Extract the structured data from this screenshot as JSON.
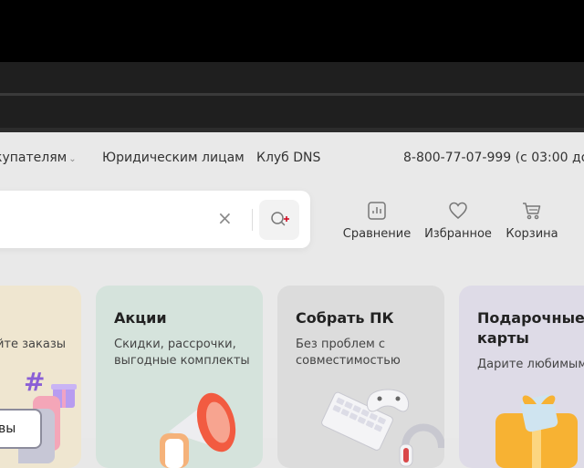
{
  "nav": {
    "buyers": "купателям",
    "legal": "Юридическим лицам",
    "club": "Клуб DNS",
    "phone": "8-800-77-07-999 (с 03:00 до"
  },
  "search": {
    "clear_glyph": "×"
  },
  "actions": {
    "compare": "Сравнение",
    "favorites": "Избранное",
    "cart": "Корзина"
  },
  "cards": {
    "orders": {
      "subtitle": "айте заказы",
      "chip": "вы"
    },
    "promo": {
      "title": "Акции",
      "subtitle": "Скидки, рассрочки, выгодные комплекты"
    },
    "pc": {
      "title": "Собрать ПК",
      "subtitle": "Без проблем с совместимостью"
    },
    "gift": {
      "title": "Подарочные карты",
      "subtitle": "Дарите любимым"
    }
  },
  "icons": {
    "search": "search-icon",
    "compare": "chart-icon",
    "favorites": "heart-icon",
    "cart": "cart-icon",
    "clear": "close-icon"
  },
  "colors": {
    "accent": "#fc8507",
    "search_plus": "#d0021b",
    "page_bg": "#e9e9e9",
    "promo_card": "#d5e3dc",
    "pc_card": "#dcdcdc",
    "gift_card": "#dedbe7",
    "orders_card": "#efe6d0"
  }
}
